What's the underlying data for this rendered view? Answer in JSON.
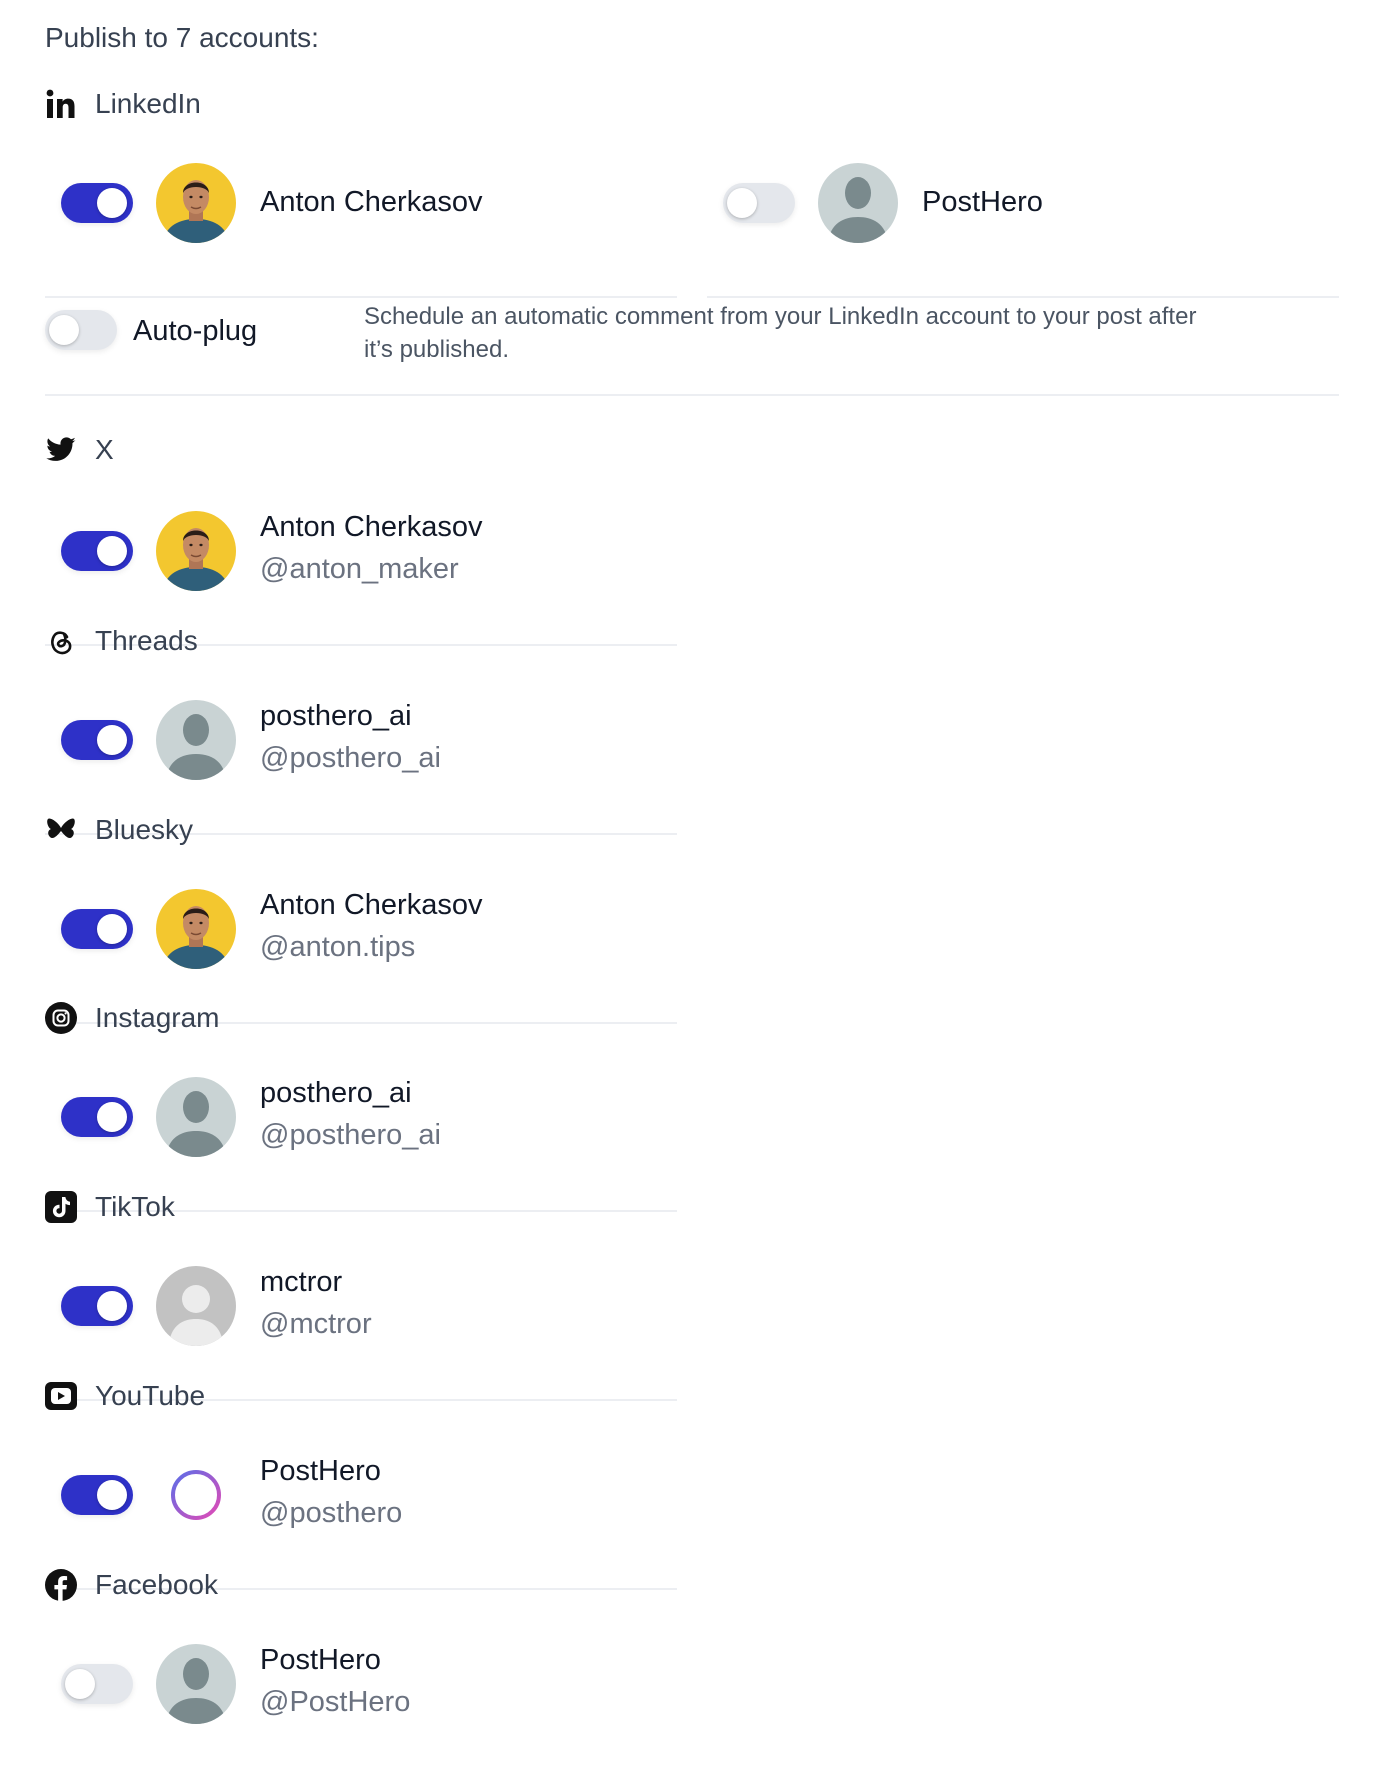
{
  "heading": "Publish to 7 accounts:",
  "platforms": {
    "linkedin": {
      "name": "LinkedIn",
      "accounts": [
        {
          "name": "Anton Cherkasov",
          "enabled": true,
          "avatar": "photo-avatar"
        },
        {
          "name": "PostHero",
          "enabled": false,
          "avatar": "silhouette-avatar"
        }
      ],
      "autoplug": {
        "label": "Auto-plug",
        "enabled": false,
        "description": "Schedule an automatic comment from your LinkedIn account to your post after it’s published."
      }
    },
    "x": {
      "name": "X",
      "account": {
        "name": "Anton Cherkasov",
        "handle": "@anton_maker",
        "enabled": true
      }
    },
    "threads": {
      "name": "Threads",
      "account": {
        "name": "posthero_ai",
        "handle": "@posthero_ai",
        "enabled": true
      }
    },
    "bluesky": {
      "name": "Bluesky",
      "account": {
        "name": "Anton Cherkasov",
        "handle": "@anton.tips",
        "enabled": true
      }
    },
    "instagram": {
      "name": "Instagram",
      "account": {
        "name": "posthero_ai",
        "handle": "@posthero_ai",
        "enabled": true
      }
    },
    "tiktok": {
      "name": "TikTok",
      "account": {
        "name": "mctror",
        "handle": "@mctror",
        "enabled": true
      }
    },
    "youtube": {
      "name": "YouTube",
      "account": {
        "name": "PostHero",
        "handle": "@posthero",
        "enabled": true
      }
    },
    "facebook": {
      "name": "Facebook",
      "account": {
        "name": "PostHero",
        "handle": "@PostHero",
        "enabled": false
      }
    }
  },
  "colors": {
    "toggle_on": "#2e31c8",
    "toggle_off": "#e4e7ec",
    "avatar_yellow": "#f3c72f",
    "silhouette_bg": "#c9d3d4",
    "silhouette_fg": "#7a8a8d"
  },
  "icons": {
    "linkedin": "linkedin-icon",
    "x": "twitter-bird-icon",
    "threads": "threads-icon",
    "bluesky": "butterfly-icon",
    "instagram": "instagram-icon",
    "tiktok": "tiktok-icon",
    "youtube": "youtube-icon",
    "facebook": "facebook-icon"
  }
}
